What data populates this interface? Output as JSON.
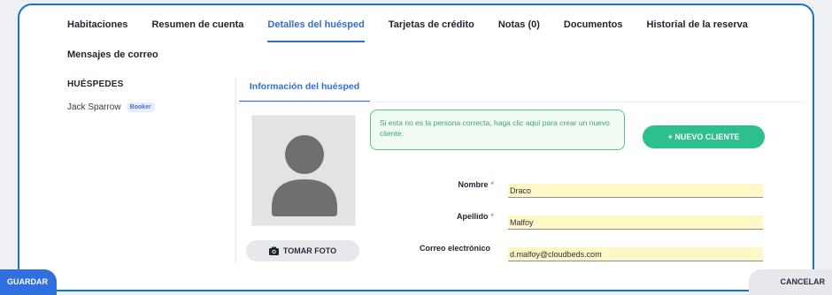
{
  "tabs": {
    "habitaciones": "Habitaciones",
    "resumen": "Resumen de cuenta",
    "detalles": "Detalles del huésped",
    "tarjetas": "Tarjetas de crédito",
    "notas": "Notas (0)",
    "documentos": "Documentos",
    "historial": "Historial de la reserva",
    "mensajes": "Mensajes de correo"
  },
  "guests": {
    "title": "HUÉSPEDES",
    "items": [
      {
        "name": "Jack Sparrow",
        "badge": "Booker"
      }
    ]
  },
  "subtab": {
    "label": "Información del huésped"
  },
  "notice": {
    "text": "Si esta no es la persona correcta, haga clic aquí para crear un nuevo cliente."
  },
  "buttons": {
    "new_client": "+ NUEVO CLIENTE",
    "take_photo": "TOMAR FOTO",
    "save": "GUARDAR",
    "cancel": "CANCELAR"
  },
  "form": {
    "nombre_label": "Nombre",
    "nombre_value": "Draco",
    "apellido_label": "Apellido",
    "apellido_value": "Malfoy",
    "email_label": "Correo electrónico",
    "email_value": "d.malfoy@cloudbeds.com",
    "required_mark": "*"
  },
  "icons": {
    "avatar": "avatar-placeholder-icon",
    "camera": "camera-icon"
  },
  "colors": {
    "accent": "#2f6fd6",
    "success": "#2dbf8e",
    "input_bg": "#fdf8c6",
    "frame": "#1e73be"
  }
}
